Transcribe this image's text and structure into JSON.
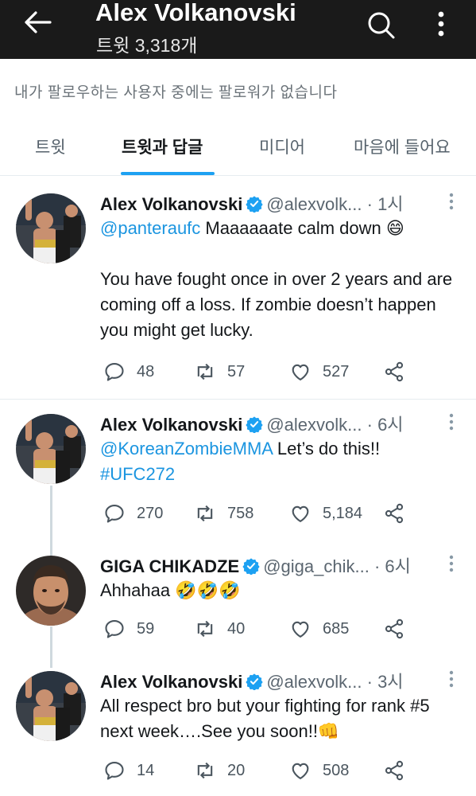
{
  "header": {
    "title": "Alex Volkanovski",
    "tweet_count": "트윗 3,318개"
  },
  "notice": "내가 팔로우하는 사용자 중에는 팔로워가 없습니다",
  "tabs": [
    {
      "label": "트윗",
      "active": false
    },
    {
      "label": "트윗과 답글",
      "active": true
    },
    {
      "label": "미디어",
      "active": false
    },
    {
      "label": "마음에 들어요",
      "active": false
    }
  ],
  "colors": {
    "accent": "#1da1f2",
    "topbar": "#1a1a1a",
    "link": "#1b95e0"
  },
  "tweets": [
    {
      "name": "Alex Volkanovski",
      "handle": "@alexvolk...",
      "time": "· 1시",
      "mention": "@panteraufc",
      "text_1": " Maaaaaate calm down 😄",
      "text_2": "You have fought once in over 2 years and are coming off a loss. If zombie doesn’t happen you might get lucky.",
      "replies": "48",
      "retweets": "57",
      "likes": "527"
    },
    {
      "name": "Alex Volkanovski",
      "handle": "@alexvolk...",
      "time": "· 6시",
      "mention": "@KoreanZombieMMA",
      "text_1": " Let’s do this!!",
      "hashtag": "#UFC272",
      "replies": "270",
      "retweets": "758",
      "likes": "5,184"
    },
    {
      "name": "GIGA CHIKADZE",
      "handle": "@giga_chik...",
      "time": "· 6시",
      "text_1": "Ahhahaa 🤣🤣🤣",
      "replies": "59",
      "retweets": "40",
      "likes": "685"
    },
    {
      "name": "Alex Volkanovski",
      "handle": "@alexvolk...",
      "time": "· 3시",
      "text_1": "All respect bro but your fighting for rank #5 next week….See you soon!!👊",
      "replies": "14",
      "retweets": "20",
      "likes": "508"
    }
  ]
}
